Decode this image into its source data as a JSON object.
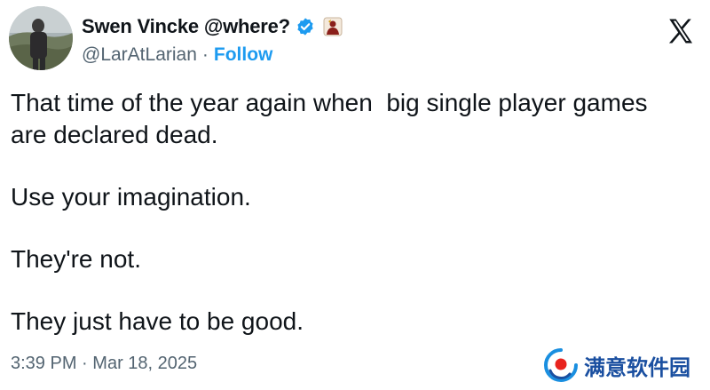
{
  "author": {
    "display_name": "Swen Vincke @where?",
    "handle": "@LarAtLarian",
    "separator": "·",
    "follow_label": "Follow",
    "avatar_icon": "profile-photo-icon",
    "verified_icon": "verified-badge-icon",
    "affiliate_icon": "affiliate-badge-icon"
  },
  "platform": {
    "logo_icon": "x-logo-icon"
  },
  "tweet": {
    "paragraphs": [
      "That time of the year again when  big single player games",
      "are declared dead.",
      "Use your imagination.",
      "They're not.",
      "They just have to be good."
    ],
    "time": "3:39 PM",
    "separator": "·",
    "date": "Mar 18, 2025"
  },
  "watermark": {
    "text": "满意软件园",
    "logo_icon": "watermark-logo-icon"
  },
  "colors": {
    "text": "#0f1419",
    "secondary": "#536471",
    "accent": "#1d9bf0",
    "watermark": "#1a4fa0"
  }
}
